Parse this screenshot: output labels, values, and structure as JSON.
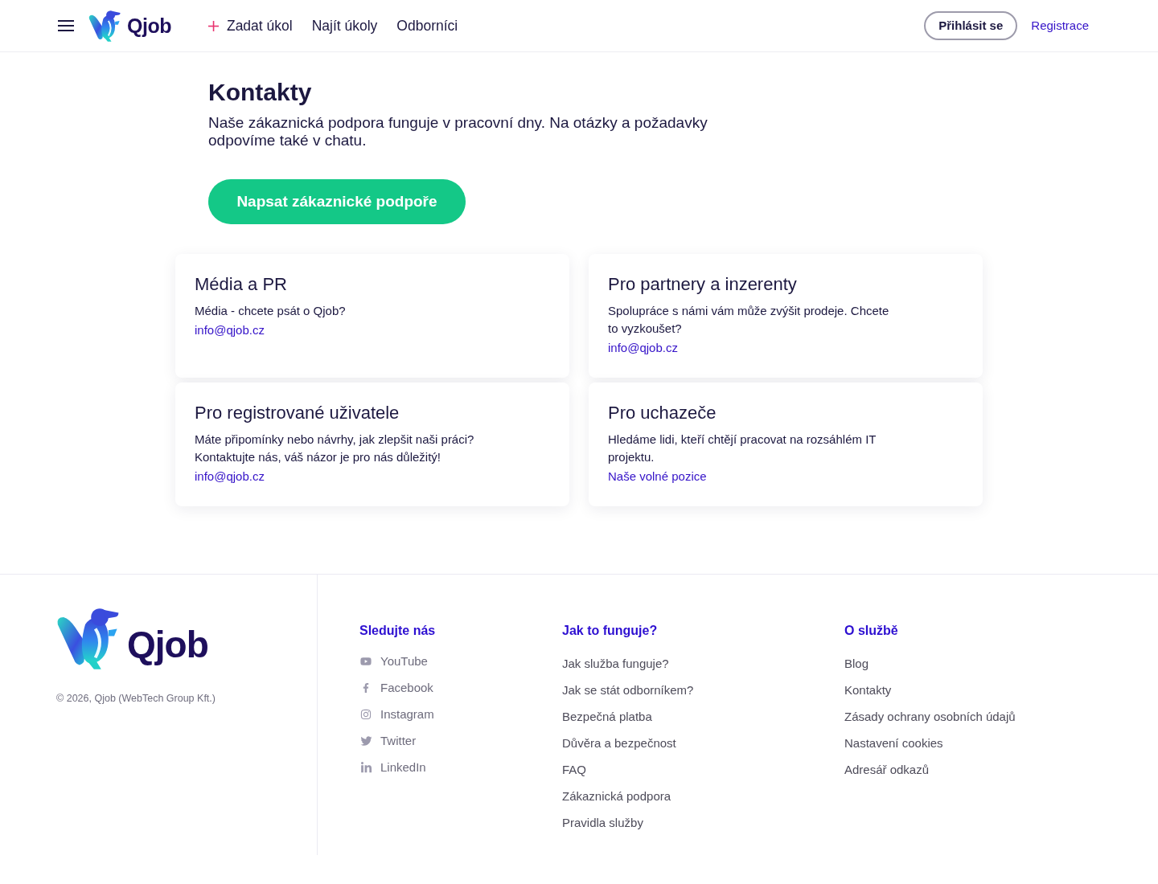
{
  "header": {
    "logo_text": "Qjob",
    "nav": [
      {
        "label": "Zadat úkol",
        "kind": "action"
      },
      {
        "label": "Najít úkoly",
        "kind": "link"
      },
      {
        "label": "Odborníci",
        "kind": "link"
      }
    ],
    "login_button": "Přihlásit se",
    "register_link": "Registrace"
  },
  "page": {
    "title": "Kontakty",
    "intro": "Naše zákaznická podpora funguje v pracovní dny. Na otázky a požadavky odpovíme také v chatu.",
    "support_button": "Napsat zákaznické podpoře"
  },
  "cards": [
    {
      "title": "Média a PR",
      "text": "Média - chcete psát o Qjob?",
      "link": "info@qjob.cz"
    },
    {
      "title": "Pro partnery a inzerenty",
      "text": "Spolupráce s námi vám může zvýšit prodeje. Chcete to vyzkoušet?",
      "link": "info@qjob.cz"
    },
    {
      "title": "Pro registrované uživatele",
      "text": "Máte připomínky nebo návrhy, jak zlepšit naši práci? Kontaktujte nás, váš názor je pro nás důležitý!",
      "link": "info@qjob.cz"
    },
    {
      "title": "Pro uchazeče",
      "text": "Hledáme lidi, kteří chtějí pracovat na rozsáhlém IT projektu.",
      "link": "Naše volné pozice"
    }
  ],
  "footer": {
    "logo_text": "Qjob",
    "copyright": "© 2026, Qjob (WebTech Group Kft.)",
    "columns": [
      {
        "heading": "Sledujte nás",
        "kind": "social",
        "links": [
          "YouTube",
          "Facebook",
          "Instagram",
          "Twitter",
          "LinkedIn"
        ]
      },
      {
        "heading": "Jak to funguje?",
        "kind": "links",
        "links": [
          "Jak služba funguje?",
          "Jak se stát odborníkem?",
          "Bezpečná platba",
          "Důvěra a bezpečnost",
          "FAQ",
          "Zákaznická podpora",
          "Pravidla služby"
        ]
      },
      {
        "heading": "O službě",
        "kind": "links",
        "links": [
          "Blog",
          "Kontakty",
          "Zásady ochrany osobních údajů",
          "Nastavení cookies",
          "Adresář odkazů"
        ]
      }
    ]
  }
}
